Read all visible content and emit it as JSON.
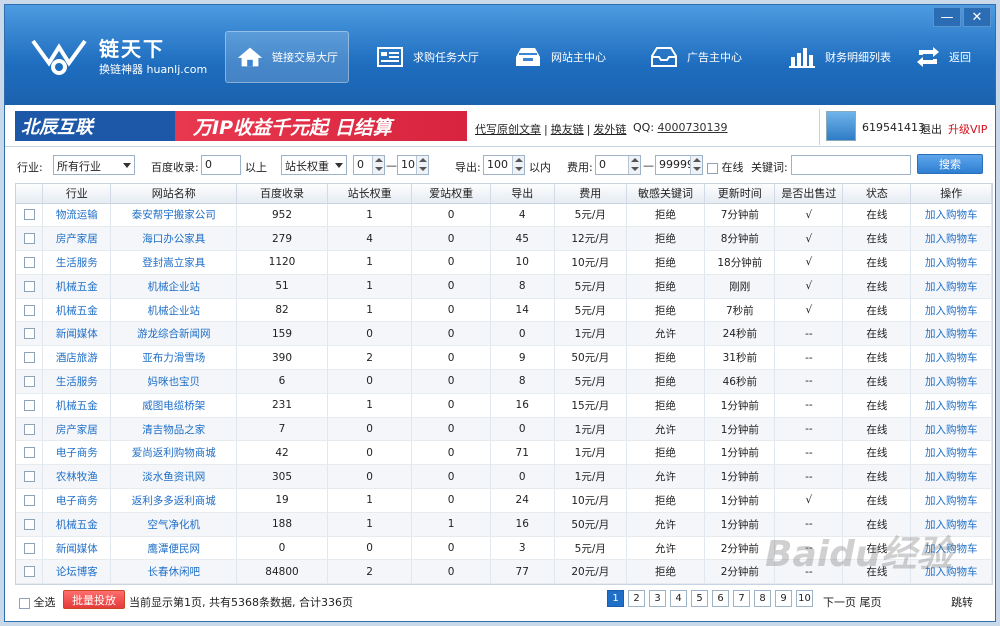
{
  "window": {
    "min_label": "—",
    "close_label": "✕"
  },
  "logo": {
    "title": "链天下",
    "subtitle": "换链神器 huanlj.com"
  },
  "nav": [
    {
      "label": "链接交易大厅",
      "icon": "home-icon",
      "active": true
    },
    {
      "label": "求购任务大厅",
      "icon": "list-icon",
      "active": false
    },
    {
      "label": "网站主中心",
      "icon": "inbox-icon",
      "active": false
    },
    {
      "label": "广告主中心",
      "icon": "tray-icon",
      "active": false
    },
    {
      "label": "财务明细列表",
      "icon": "bar-chart-icon",
      "active": false
    },
    {
      "label": "返回",
      "icon": "refresh-icon",
      "active": false
    }
  ],
  "banner": {
    "brand": "北辰互联",
    "slogan": "万IP收益千元起 日结算"
  },
  "links": [
    "代写原创文章",
    "换友链",
    "发外链"
  ],
  "qq": {
    "label": "QQ:",
    "number": "4000730139"
  },
  "user": {
    "id": "619541413",
    "logout": "退出",
    "upgrade": "升级VIP"
  },
  "filters": {
    "industry_label": "行业:",
    "industry_value": "所有行业",
    "baidu_label": "百度收录:",
    "baidu_value": "0",
    "baidu_suffix": "以上",
    "weight_select": "站长权重",
    "weight_min": "0",
    "weight_dash": "—",
    "weight_max": "10",
    "export_label": "导出:",
    "export_value": "100",
    "export_suffix": "以内",
    "fee_label": "费用:",
    "fee_min": "0",
    "fee_dash": "—",
    "fee_max": "99999",
    "online_label": "在线",
    "keyword_label": "关键词:",
    "search_button": "搜索"
  },
  "table": {
    "columns": [
      "",
      "行业",
      "网站名称",
      "百度收录",
      "站长权重",
      "爱站权重",
      "导出",
      "费用",
      "敏感关键词",
      "更新时间",
      "是否出售过",
      "状态",
      "操作"
    ],
    "rows": [
      [
        "物流运输",
        "泰安帮宇搬家公司",
        "952",
        "1",
        "0",
        "4",
        "5元/月",
        "拒绝",
        "7分钟前",
        "√",
        "在线",
        "加入购物车"
      ],
      [
        "房产家居",
        "海口办公家具",
        "279",
        "4",
        "0",
        "45",
        "12元/月",
        "拒绝",
        "8分钟前",
        "√",
        "在线",
        "加入购物车"
      ],
      [
        "生活服务",
        "登封嵩立家具",
        "1120",
        "1",
        "0",
        "10",
        "10元/月",
        "拒绝",
        "18分钟前",
        "√",
        "在线",
        "加入购物车"
      ],
      [
        "机械五金",
        "机械企业站",
        "51",
        "1",
        "0",
        "8",
        "5元/月",
        "拒绝",
        "刚刚",
        "√",
        "在线",
        "加入购物车"
      ],
      [
        "机械五金",
        "机械企业站",
        "82",
        "1",
        "0",
        "14",
        "5元/月",
        "拒绝",
        "7秒前",
        "√",
        "在线",
        "加入购物车"
      ],
      [
        "新闻媒体",
        "游龙综合新闻网",
        "159",
        "0",
        "0",
        "0",
        "1元/月",
        "允许",
        "24秒前",
        "--",
        "在线",
        "加入购物车"
      ],
      [
        "酒店旅游",
        "亚布力滑雪场",
        "390",
        "2",
        "0",
        "9",
        "50元/月",
        "拒绝",
        "31秒前",
        "--",
        "在线",
        "加入购物车"
      ],
      [
        "生活服务",
        "妈咪也宝贝",
        "6",
        "0",
        "0",
        "8",
        "5元/月",
        "拒绝",
        "46秒前",
        "--",
        "在线",
        "加入购物车"
      ],
      [
        "机械五金",
        "威图电缆桥架",
        "231",
        "1",
        "0",
        "16",
        "15元/月",
        "拒绝",
        "1分钟前",
        "--",
        "在线",
        "加入购物车"
      ],
      [
        "房产家居",
        "清吉物品之家",
        "7",
        "0",
        "0",
        "0",
        "1元/月",
        "允许",
        "1分钟前",
        "--",
        "在线",
        "加入购物车"
      ],
      [
        "电子商务",
        "爱尚返利购物商城",
        "42",
        "0",
        "0",
        "71",
        "1元/月",
        "拒绝",
        "1分钟前",
        "--",
        "在线",
        "加入购物车"
      ],
      [
        "农林牧渔",
        "淡水鱼资讯网",
        "305",
        "0",
        "0",
        "0",
        "1元/月",
        "允许",
        "1分钟前",
        "--",
        "在线",
        "加入购物车"
      ],
      [
        "电子商务",
        "返利多多返利商城",
        "19",
        "1",
        "0",
        "24",
        "10元/月",
        "拒绝",
        "1分钟前",
        "√",
        "在线",
        "加入购物车"
      ],
      [
        "机械五金",
        "空气净化机",
        "188",
        "1",
        "1",
        "16",
        "50元/月",
        "允许",
        "1分钟前",
        "--",
        "在线",
        "加入购物车"
      ],
      [
        "新闻媒体",
        "鹰潭便民网",
        "0",
        "0",
        "0",
        "3",
        "5元/月",
        "允许",
        "2分钟前",
        "--",
        "在线",
        "加入购物车"
      ],
      [
        "论坛博客",
        "长春休闲吧",
        "84800",
        "2",
        "0",
        "77",
        "20元/月",
        "拒绝",
        "2分钟前",
        "--",
        "在线",
        "加入购物车"
      ]
    ]
  },
  "footer": {
    "select_all": "全选",
    "batch_button": "批量投放",
    "page_info": "当前显示第1页, 共有5368条数据, 合计336页",
    "pages": [
      "1",
      "2",
      "3",
      "4",
      "5",
      "6",
      "7",
      "8",
      "9",
      "10"
    ],
    "nav_text": "下一页 尾页",
    "jump": "跳转"
  },
  "watermark": "Baidu经验"
}
